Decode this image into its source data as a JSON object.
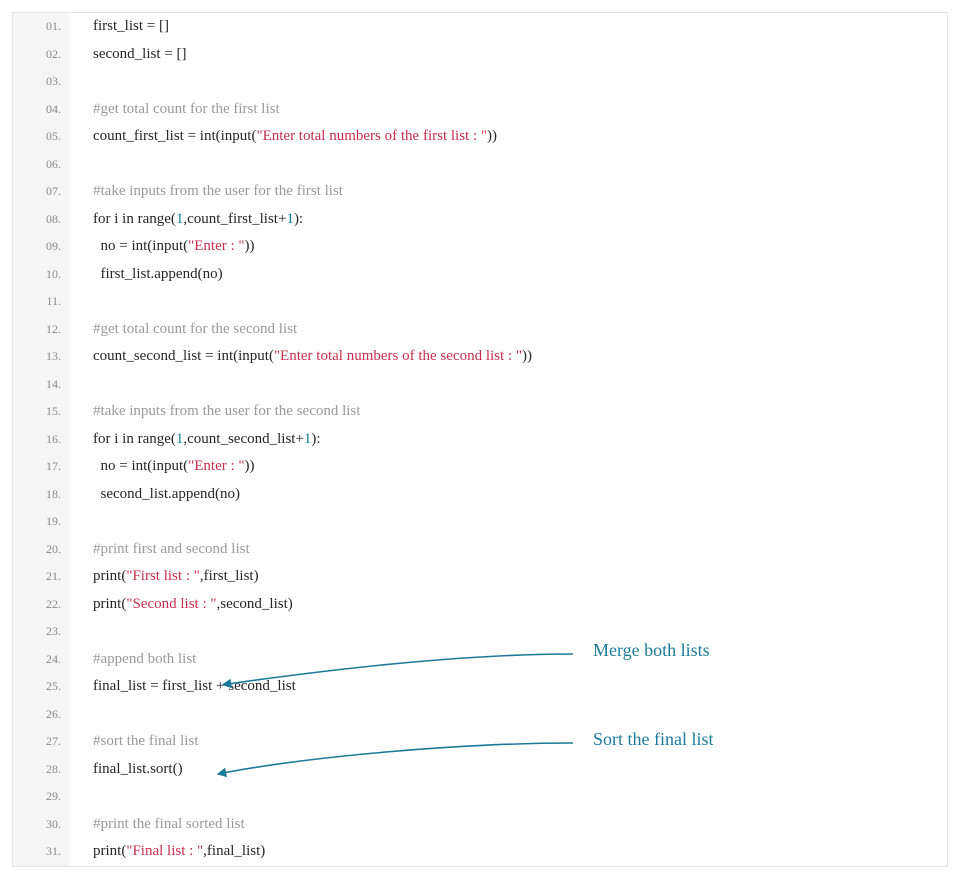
{
  "colors": {
    "comment": "#9a9a9a",
    "string": "#c72e4c",
    "number": "#0c7aa0",
    "default": "#262626",
    "annotation": "#1b7a99"
  },
  "annotations": [
    {
      "label": "Merge both lists"
    },
    {
      "label": "Sort the final list"
    }
  ],
  "code": {
    "lines": [
      {
        "n": "01.",
        "tokens": [
          {
            "t": "first_list = []",
            "c": "d"
          }
        ]
      },
      {
        "n": "02.",
        "tokens": [
          {
            "t": "second_list = []",
            "c": "d"
          }
        ]
      },
      {
        "n": "03.",
        "tokens": []
      },
      {
        "n": "04.",
        "tokens": [
          {
            "t": "#get total count for the first list",
            "c": "cm"
          }
        ]
      },
      {
        "n": "05.",
        "tokens": [
          {
            "t": "count_first_list = int(input(",
            "c": "d"
          },
          {
            "t": "\"Enter total numbers of the first list : \"",
            "c": "s"
          },
          {
            "t": "))",
            "c": "d"
          }
        ]
      },
      {
        "n": "06.",
        "tokens": []
      },
      {
        "n": "07.",
        "tokens": [
          {
            "t": "#take inputs from the user for the first list",
            "c": "cm"
          }
        ]
      },
      {
        "n": "08.",
        "tokens": [
          {
            "t": "for i in range(",
            "c": "d"
          },
          {
            "t": "1",
            "c": "n"
          },
          {
            "t": ",count_first_list+",
            "c": "d"
          },
          {
            "t": "1",
            "c": "n"
          },
          {
            "t": "):",
            "c": "d"
          }
        ]
      },
      {
        "n": "09.",
        "tokens": [
          {
            "t": "  no = int(input(",
            "c": "d"
          },
          {
            "t": "\"Enter : \"",
            "c": "s"
          },
          {
            "t": "))",
            "c": "d"
          }
        ]
      },
      {
        "n": "10.",
        "tokens": [
          {
            "t": "  first_list.append(no)",
            "c": "d"
          }
        ]
      },
      {
        "n": "11.",
        "tokens": []
      },
      {
        "n": "12.",
        "tokens": [
          {
            "t": "#get total count for the second list",
            "c": "cm"
          }
        ]
      },
      {
        "n": "13.",
        "tokens": [
          {
            "t": "count_second_list = int(input(",
            "c": "d"
          },
          {
            "t": "\"Enter total numbers of the second list : \"",
            "c": "s"
          },
          {
            "t": "))",
            "c": "d"
          }
        ]
      },
      {
        "n": "14.",
        "tokens": []
      },
      {
        "n": "15.",
        "tokens": [
          {
            "t": "#take inputs from the user for the second list",
            "c": "cm"
          }
        ]
      },
      {
        "n": "16.",
        "tokens": [
          {
            "t": "for i in range(",
            "c": "d"
          },
          {
            "t": "1",
            "c": "n"
          },
          {
            "t": ",count_second_list+",
            "c": "d"
          },
          {
            "t": "1",
            "c": "n"
          },
          {
            "t": "):",
            "c": "d"
          }
        ]
      },
      {
        "n": "17.",
        "tokens": [
          {
            "t": "  no = int(input(",
            "c": "d"
          },
          {
            "t": "\"Enter : \"",
            "c": "s"
          },
          {
            "t": "))",
            "c": "d"
          }
        ]
      },
      {
        "n": "18.",
        "tokens": [
          {
            "t": "  second_list.append(no)",
            "c": "d"
          }
        ]
      },
      {
        "n": "19.",
        "tokens": []
      },
      {
        "n": "20.",
        "tokens": [
          {
            "t": "#print first and second list",
            "c": "cm"
          }
        ]
      },
      {
        "n": "21.",
        "tokens": [
          {
            "t": "print(",
            "c": "d"
          },
          {
            "t": "\"First list : \"",
            "c": "s"
          },
          {
            "t": ",first_list)",
            "c": "d"
          }
        ]
      },
      {
        "n": "22.",
        "tokens": [
          {
            "t": "print(",
            "c": "d"
          },
          {
            "t": "\"Second list : \"",
            "c": "s"
          },
          {
            "t": ",second_list)",
            "c": "d"
          }
        ]
      },
      {
        "n": "23.",
        "tokens": []
      },
      {
        "n": "24.",
        "tokens": [
          {
            "t": "#append both list",
            "c": "cm"
          }
        ]
      },
      {
        "n": "25.",
        "tokens": [
          {
            "t": "final_list = first_list + second_list",
            "c": "d"
          }
        ]
      },
      {
        "n": "26.",
        "tokens": []
      },
      {
        "n": "27.",
        "tokens": [
          {
            "t": "#sort the final list",
            "c": "cm"
          }
        ]
      },
      {
        "n": "28.",
        "tokens": [
          {
            "t": "final_list.sort()",
            "c": "d"
          }
        ]
      },
      {
        "n": "29.",
        "tokens": []
      },
      {
        "n": "30.",
        "tokens": [
          {
            "t": "#print the final sorted list",
            "c": "cm"
          }
        ]
      },
      {
        "n": "31.",
        "tokens": [
          {
            "t": "print(",
            "c": "d"
          },
          {
            "t": "\"Final list : \"",
            "c": "s"
          },
          {
            "t": ",final_list)",
            "c": "d"
          }
        ]
      }
    ]
  }
}
